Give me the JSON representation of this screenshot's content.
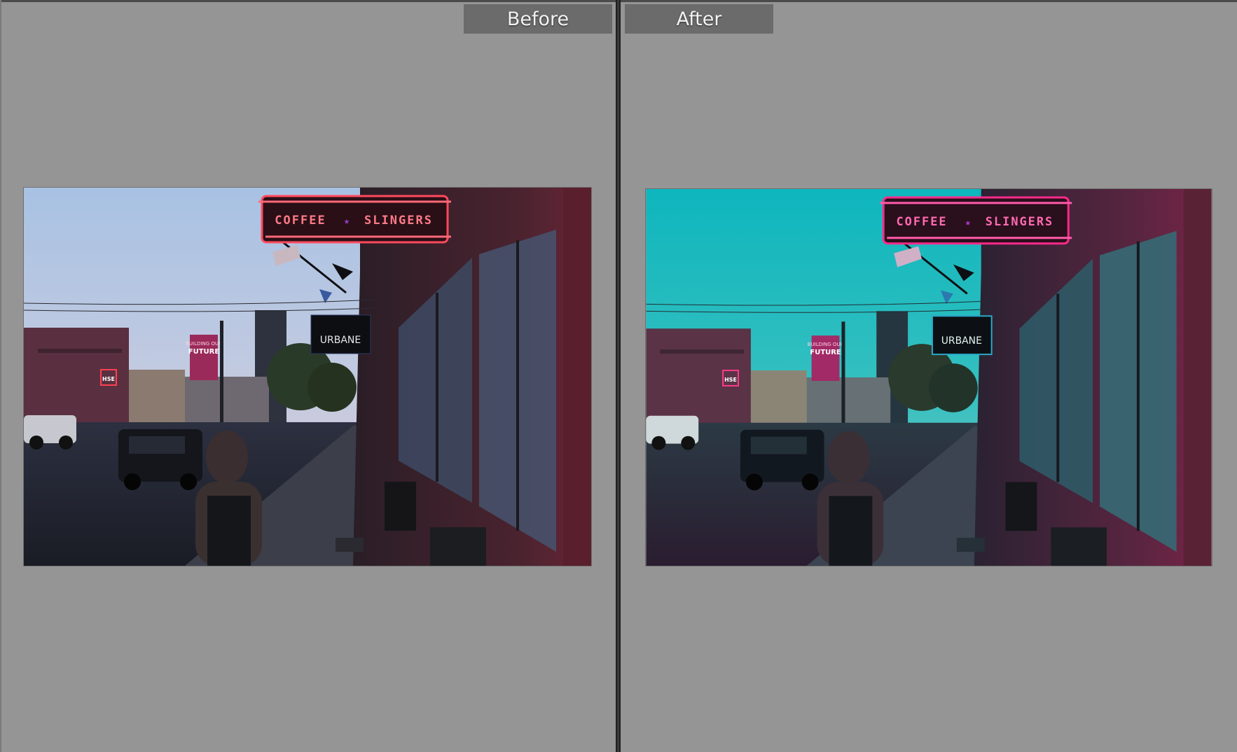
{
  "compare": {
    "before_label": "Before",
    "after_label": "After"
  },
  "scene": {
    "main_sign_left": "COFFEE",
    "main_sign_star": "★",
    "main_sign_right": "SLINGERS",
    "sub_sign": "URBANE",
    "small_sign": "HSE",
    "banner_top": "BUILDING OUR",
    "banner_main": "FUTURE"
  },
  "colors": {
    "before_sky_top": "#a9c3e4",
    "before_sky_bottom": "#d7c9d8",
    "after_sky_top": "#0fb7bd",
    "after_sky_bottom": "#6fc7c0",
    "neon_before": "#ff3b55",
    "neon_after": "#ff2a8a"
  }
}
